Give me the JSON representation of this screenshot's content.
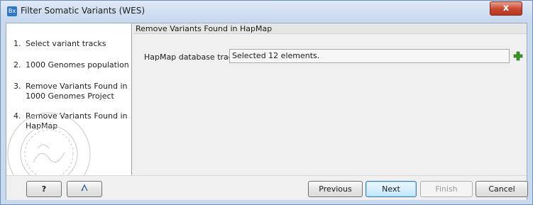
{
  "window": {
    "title": "Filter Somatic Variants (WES)",
    "app_icon_text": "Bx",
    "close_label": "x"
  },
  "steps": [
    {
      "num": "1.",
      "label": "Select variant tracks"
    },
    {
      "num": "2.",
      "label": "1000 Genomes population"
    },
    {
      "num": "3.",
      "label": "Remove Variants Found in 1000 Genomes Project"
    },
    {
      "num": "4.",
      "label": "Remove Variants Found in HapMap"
    }
  ],
  "section": {
    "header": "Remove Variants Found in HapMap",
    "field_label": "HapMap database track",
    "field_value": "Selected 12 elements.",
    "add_icon": "plus-icon"
  },
  "buttons": {
    "help": "?",
    "reset_icon": "undo-arrow-icon",
    "previous": "Previous",
    "next": "Next",
    "finish": "Finish",
    "cancel": "Cancel"
  },
  "colors": {
    "window_frame": "#c9d9ee",
    "close_button": "#c6472f",
    "add_icon": "#3a9a2a",
    "default_button_border": "#3c7fb1"
  }
}
